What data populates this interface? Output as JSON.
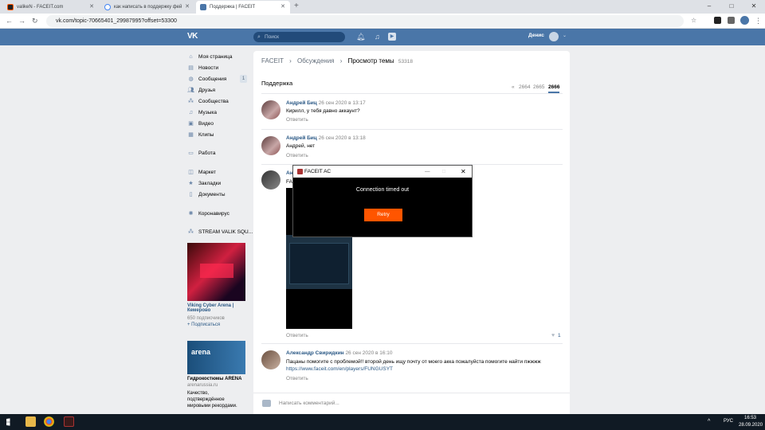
{
  "browser": {
    "tabs": [
      {
        "label": "valikeN - FACEIT.com",
        "active": false
      },
      {
        "label": "как написать в поддержку фей",
        "active": false
      },
      {
        "label": "Поддержка | FACEIT",
        "active": true
      }
    ],
    "new_tab": "+",
    "url": "vk.com/topic-70665401_29987995?offset=53300"
  },
  "vk": {
    "logo": "VK",
    "search_placeholder": "Поиск",
    "user_name": "Денис",
    "sidebar": {
      "items": [
        {
          "label": "Моя страница",
          "icon": "home-icon"
        },
        {
          "label": "Новости",
          "icon": "news-icon"
        },
        {
          "label": "Сообщения",
          "icon": "chat-icon",
          "badge": "1"
        },
        {
          "label": "Друзья",
          "icon": "friends-icon"
        },
        {
          "label": "Сообщества",
          "icon": "groups-icon"
        },
        {
          "label": "Музыка",
          "icon": "music-icon"
        },
        {
          "label": "Видео",
          "icon": "video-icon"
        },
        {
          "label": "Клипы",
          "icon": "clips-icon"
        },
        {
          "label": "Работа",
          "icon": "work-icon"
        },
        {
          "label": "Маркет",
          "icon": "market-icon"
        },
        {
          "label": "Закладки",
          "icon": "bookmark-icon"
        },
        {
          "label": "Документы",
          "icon": "docs-icon"
        },
        {
          "label": "Коронавирус",
          "icon": "virus-icon"
        },
        {
          "label": "STREAM VALIK SQU...",
          "icon": "group-icon"
        }
      ],
      "ad1": {
        "title": "Viking Cyber Arena | Кемерово",
        "subs": "650 подписчиков",
        "action": "+ Подписаться"
      },
      "ad2": {
        "title": "Гидрокостюмы ARENA",
        "domain": "arenarussia.ru",
        "text": "Качество, подтверждённое мировыми рекордами.",
        "logo": "arena"
      }
    },
    "breadcrumb": [
      "FACEIT",
      "Обсуждения",
      "Просмотр темы"
    ],
    "topic_count": "53318",
    "section_title": "Поддержка",
    "pagination": [
      "«",
      "2664",
      "2665",
      "2666"
    ],
    "posts": [
      {
        "author": "Андрей Биц",
        "date": "26 сен 2020 в 13:17",
        "text": "Кирилл, у тебя давно аккаунт?",
        "reply": "Ответить"
      },
      {
        "author": "Андрей Биц",
        "date": "26 сен 2020 в 13:18",
        "text": "Андрей, нет",
        "reply": "Ответить"
      },
      {
        "author": "Ан",
        "date": "",
        "text": "FA",
        "reply": "Ответить",
        "likes": "1"
      },
      {
        "author": "Александр Свиридкин",
        "date": "26 сен 2020 в 16:10",
        "text": "Пацаны помогите с проблемой!! второй день ищу почту от моего акка пожалуйста помогите найти пжжжж",
        "link": "https://www.faceit.com/en/players/FUNGUSYT",
        "reply": "Ответить"
      }
    ],
    "comment_placeholder": "Написать комментарий..."
  },
  "popup": {
    "title": "FACEIT AC",
    "message": "Connection timed out",
    "retry": "Retry"
  },
  "taskbar": {
    "lang": "РУС",
    "time": "16:53",
    "date": "28.09.2020"
  }
}
